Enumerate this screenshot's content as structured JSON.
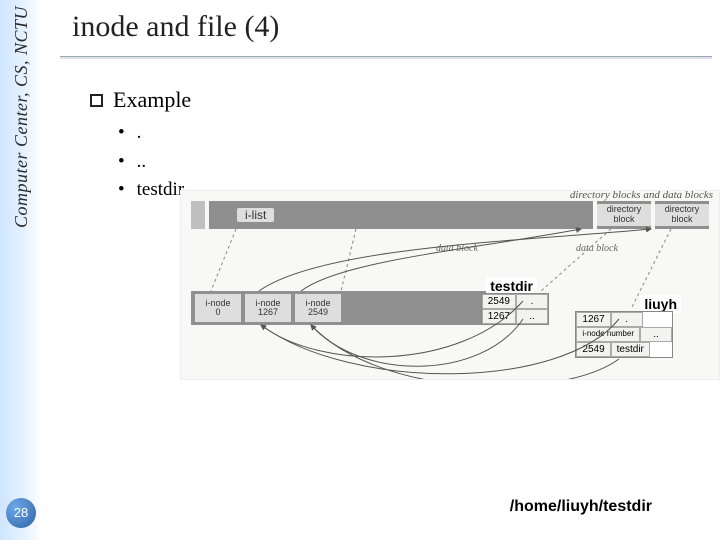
{
  "sidebar": {
    "affiliation": "Computer Center, CS, NCTU",
    "page_number": "28"
  },
  "slide": {
    "title": "inode and file (4)",
    "section": "Example",
    "items": [
      ".",
      "..",
      "testdir"
    ]
  },
  "diagram": {
    "top_label_left": "i-list",
    "top_label_right": "directory blocks and data blocks",
    "dir_block_label": "directory block",
    "data_hint": "data block",
    "inodes": [
      {
        "label": "i-node",
        "num": "0"
      },
      {
        "label": "i-node",
        "num": "1267"
      },
      {
        "label": "i-node",
        "num": "2549"
      }
    ],
    "annot_testdir": "testdir",
    "annot_liuyh": "liuyh",
    "dir_table_testdir": [
      {
        "inode": "2549",
        "name": "."
      },
      {
        "inode": "1267",
        "name": ".."
      }
    ],
    "dir_table_liuyh": [
      {
        "inode": "1267",
        "name": "."
      },
      {
        "inode": "i-node number",
        "name": ".."
      },
      {
        "inode": "2549",
        "name": "testdir"
      }
    ]
  },
  "footer": {
    "path": "/home/liuyh/testdir"
  }
}
